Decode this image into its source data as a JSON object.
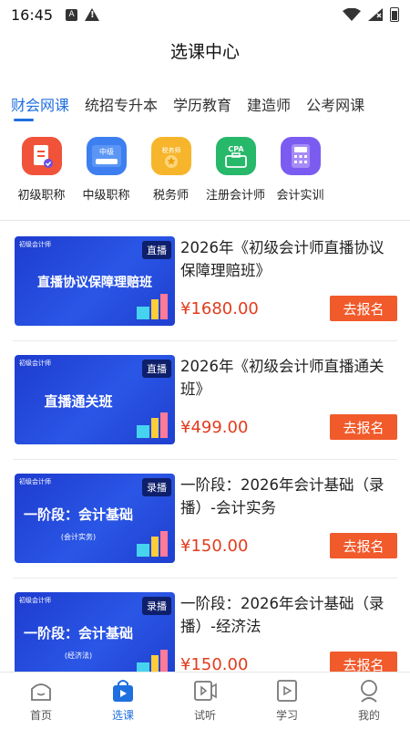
{
  "status_bar": {
    "time": "16:45",
    "notif_icon_a": "A"
  },
  "header": {
    "title": "选课中心"
  },
  "tabs": [
    {
      "label": "财会网课",
      "active": true
    },
    {
      "label": "统招专升本",
      "active": false
    },
    {
      "label": "学历教育",
      "active": false
    },
    {
      "label": "建造师",
      "active": false
    },
    {
      "label": "公考网课",
      "active": false
    }
  ],
  "subcategories": [
    {
      "label": "初级职称",
      "icon": "document-check-icon",
      "color": "#f0533a"
    },
    {
      "label": "中级职称",
      "icon": "middle-level-card-icon",
      "color": "#3d7ff0",
      "icon_text": "中级"
    },
    {
      "label": "税务师",
      "icon": "tax-badge-icon",
      "color": "#f6b52a",
      "icon_text": "税务师"
    },
    {
      "label": "注册会计师",
      "icon": "cpa-briefcase-icon",
      "color": "#27b86a",
      "icon_text": "CPA"
    },
    {
      "label": "会计实训",
      "icon": "calculator-icon",
      "color": "#7b5cf0"
    }
  ],
  "courses": [
    {
      "thumb_brand": "初级会计师",
      "thumb_tag": "直播",
      "thumb_text": "直播协议保障理赔班",
      "thumb_sub": "",
      "title": "2026年《初级会计师直播协议保障理赔班》",
      "price": "¥1680.00",
      "button": "去报名"
    },
    {
      "thumb_brand": "初级会计师",
      "thumb_tag": "直播",
      "thumb_text": "直播通关班",
      "thumb_sub": "",
      "title": "2026年《初级会计师直播通关班》",
      "price": "¥499.00",
      "button": "去报名"
    },
    {
      "thumb_brand": "初级会计师",
      "thumb_tag": "录播",
      "thumb_text": "一阶段：会计基础",
      "thumb_sub": "(会计实务)",
      "title": "一阶段：2026年会计基础（录播）-会计实务",
      "price": "¥150.00",
      "button": "去报名"
    },
    {
      "thumb_brand": "初级会计师",
      "thumb_tag": "录播",
      "thumb_text": "一阶段：会计基础",
      "thumb_sub": "(经济法)",
      "title": "一阶段：2026年会计基础（录播）-经济法",
      "price": "¥150.00",
      "button": "去报名"
    }
  ],
  "bottom_nav": [
    {
      "label": "首页",
      "icon": "home-icon",
      "active": false
    },
    {
      "label": "选课",
      "icon": "shopping-bag-icon",
      "active": true
    },
    {
      "label": "试听",
      "icon": "video-play-icon",
      "active": false
    },
    {
      "label": "学习",
      "icon": "study-play-icon",
      "active": false
    },
    {
      "label": "我的",
      "icon": "profile-icon",
      "active": false
    }
  ],
  "colors": {
    "accent": "#1f6fe0",
    "price": "#e23c1d",
    "button": "#f15a2b"
  }
}
